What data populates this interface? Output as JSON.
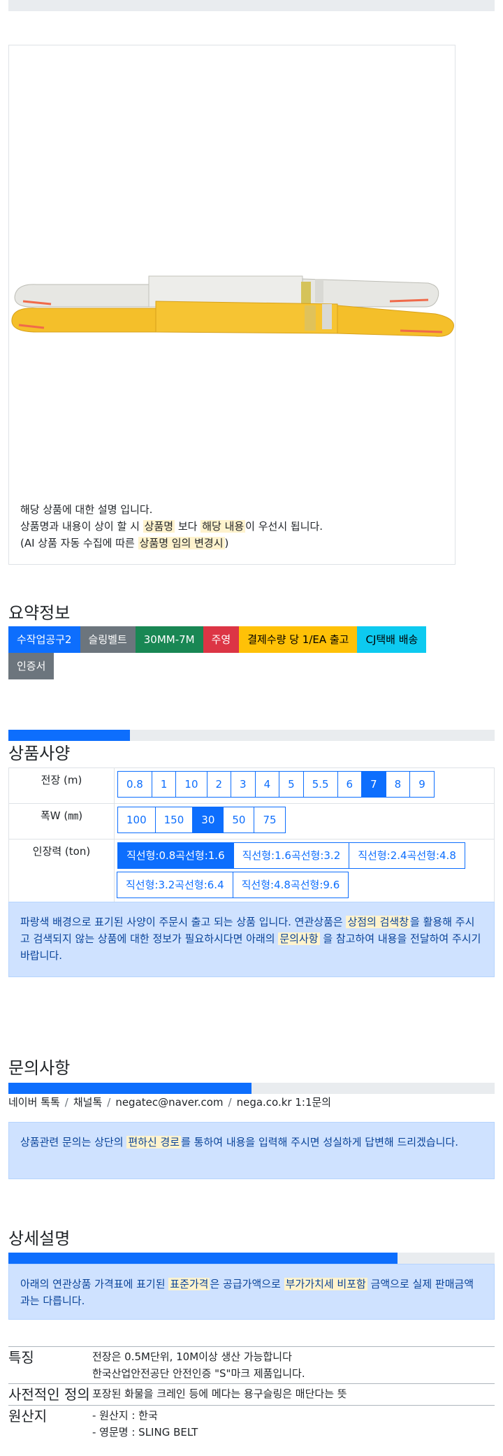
{
  "product_description": {
    "line1": "해당 상품에 대한 설명 입니다.",
    "line2_a": "상품명과 내용이 상이 할 시 ",
    "line2_hl1": "상품명",
    "line2_b": " 보다 ",
    "line2_hl2": "해당 내용",
    "line2_c": "이 우선시 됩니다.",
    "line3_a": "(AI 상품 자동 수집에 따른 ",
    "line3_hl": "상품명 임의 변경시",
    "line3_b": ")"
  },
  "summary": {
    "title": "요약정보",
    "badges": [
      {
        "label": "수작업공구2",
        "color": "#0d6efd"
      },
      {
        "label": "슬링벨트",
        "color": "#6c757d"
      },
      {
        "label": "30MM-7M",
        "color": "#198754"
      },
      {
        "label": "주영",
        "color": "#dc3545"
      },
      {
        "label": "결제수량 당 1/EA 출고",
        "color": "#ffc107"
      },
      {
        "label": "CJ택배 배송",
        "color": "#0dcaf0"
      },
      {
        "label": "인증서",
        "color": "#6c757d"
      }
    ],
    "progress_fraction": 0.25
  },
  "specs": {
    "title": "상품사양",
    "rows": [
      {
        "label": "전장 (m)",
        "options": [
          "0.8",
          "1",
          "10",
          "2",
          "3",
          "4",
          "5",
          "5.5",
          "6",
          "7",
          "8",
          "9"
        ],
        "selected": "7"
      },
      {
        "label": "폭W (㎜)",
        "options": [
          "100",
          "150",
          "30",
          "50",
          "75"
        ],
        "selected": "30"
      },
      {
        "label": "인장력 (ton)",
        "options": [
          "직선형:0.8곡선형:1.6",
          "직선형:1.6곡선형:3.2",
          "직선형:2.4곡선형:4.8",
          "직선형:3.2곡선형:6.4",
          "직선형:4.8곡선형:9.6"
        ],
        "selected": "직선형:0.8곡선형:1.6"
      }
    ],
    "notice_a": "파랑색 배경으로 표기된 사양이 주문시 출고 되는 상품 입니다. 연관상품은 ",
    "notice_hl1": "상점의 검색창",
    "notice_b": "을 활용해 주시고 검색되지 않는 상품에 대한 정보가 필요하시다면 아래의 ",
    "notice_hl2": "문의사항",
    "notice_c": " 을 참고하여 내용을 전달하여 주시기 바랍니다."
  },
  "inquiry": {
    "title": "문의사항",
    "progress_fraction": 0.5,
    "links": [
      "네이버 톡톡",
      "채널톡",
      "negatec@naver.com",
      "nega.co.kr 1:1문의"
    ],
    "notice_a": "상품관련 문의는 상단의 ",
    "notice_hl": "편하신 경로",
    "notice_b": "를 통하여 내용을 입력해 주시면 성실하게 답변해 드리겠습니다."
  },
  "details": {
    "title": "상세설명",
    "progress_fraction": 0.8,
    "notice_a": "아래의 연관상품 가격표에 표기된 ",
    "notice_hl1": "표준가격",
    "notice_b": "은 공급가액으로 ",
    "notice_hl2": "부가가치세 비포함",
    "notice_c": " 금액으로 실제 판매금액과는 다릅니다.",
    "rows": [
      {
        "key": "특징",
        "values": [
          "전장은 0.5M단위, 10M이상 생산 가능합니다",
          "한국산업안전공단 안전인증 \"S\"마크 제품입니다."
        ]
      },
      {
        "key": "사전적인 정의",
        "values": [
          "포장된 화물을 크레인 등에 메다는 용구슬링은 매단다는 뜻"
        ]
      },
      {
        "key": "원산지",
        "values": [
          "- 원산지 : 한국",
          "- 영문명 : SLING BELT"
        ]
      }
    ]
  }
}
